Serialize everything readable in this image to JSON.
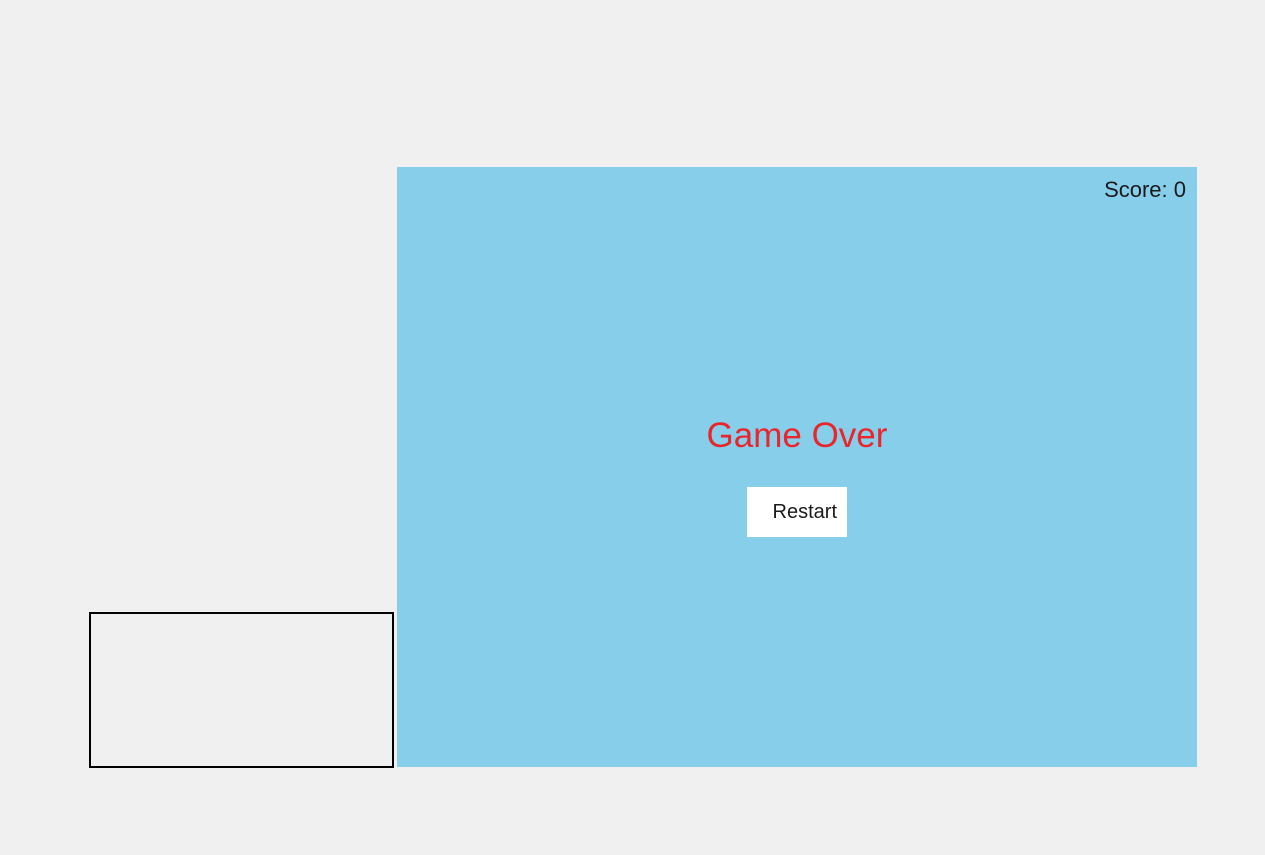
{
  "game": {
    "score_text": "Score: 0",
    "game_over_text": "Game Over",
    "restart_label": "Restart"
  },
  "colors": {
    "background": "#f0f0f0",
    "game_area": "#87ceeb",
    "game_over_text": "#e8262b",
    "button_background": "#ffffff",
    "box_border": "#000000"
  }
}
